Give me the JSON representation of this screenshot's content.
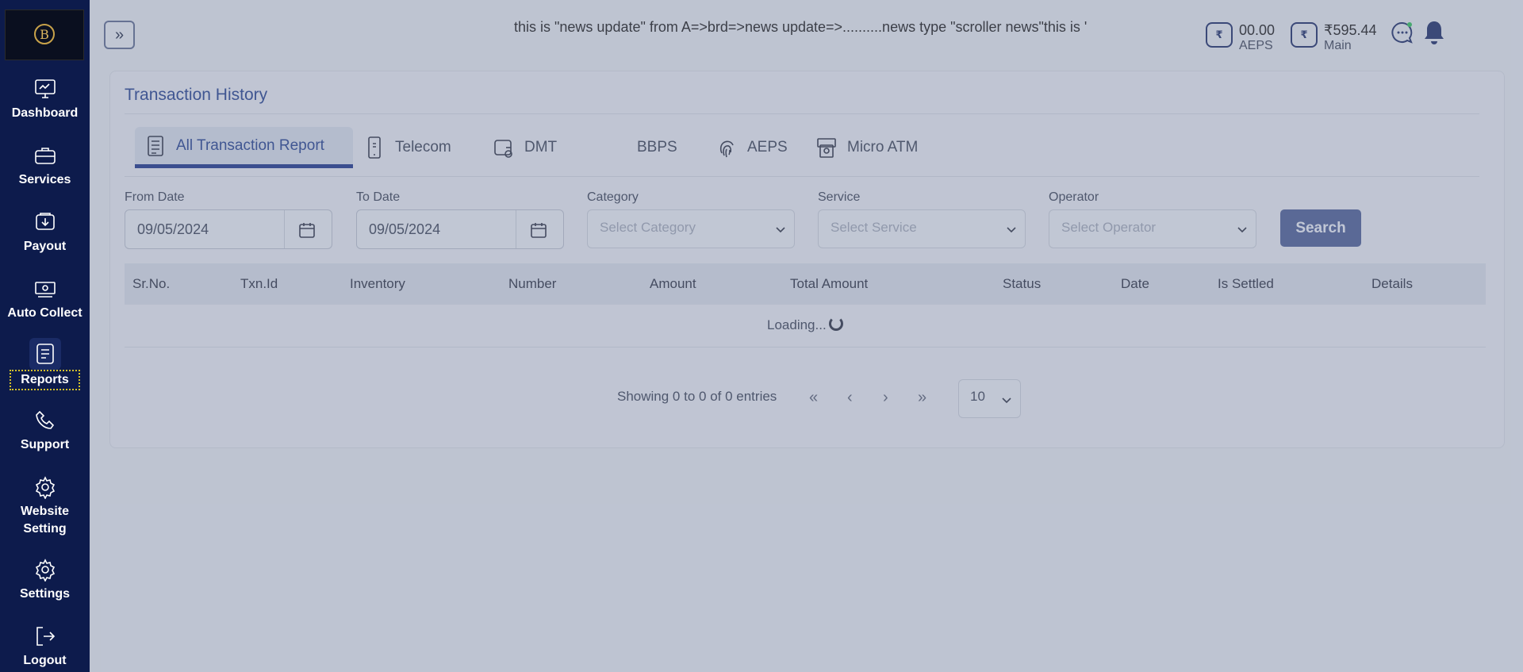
{
  "sidebar": {
    "logo_text": "B",
    "items": [
      {
        "label": "Dashboard",
        "icon": "dashboard-icon"
      },
      {
        "label": "Services",
        "icon": "briefcase-icon"
      },
      {
        "label": "Payout",
        "icon": "payout-icon"
      },
      {
        "label": "Auto Collect",
        "icon": "auto-collect-icon"
      },
      {
        "label": "Reports",
        "icon": "reports-icon"
      },
      {
        "label": "Support",
        "icon": "phone-icon"
      },
      {
        "label": "Website Setting",
        "icon": "gear-icon"
      },
      {
        "label": "Settings",
        "icon": "gear-icon"
      },
      {
        "label": "Logout",
        "icon": "logout-icon"
      }
    ]
  },
  "header": {
    "toggle_symbol": "»",
    "news": "this is \"news update\" from A=>brd=>news update=>..........news type \"scroller news\"this is '",
    "wallets": [
      {
        "amount": "00.00",
        "name": "AEPS"
      },
      {
        "amount": "₹595.44",
        "name": "Main"
      }
    ]
  },
  "page": {
    "title": "Transaction History",
    "tabs": [
      {
        "label": "All Transaction Report",
        "icon": "report-list-icon",
        "active": true
      },
      {
        "label": "Telecom",
        "icon": "mobile-icon"
      },
      {
        "label": "DMT",
        "icon": "wallet-transfer-icon"
      },
      {
        "label": "BBPS",
        "icon": ""
      },
      {
        "label": "AEPS",
        "icon": "fingerprint-icon"
      },
      {
        "label": "Micro ATM",
        "icon": "atm-icon"
      }
    ]
  },
  "filters": {
    "from_date_label": "From Date",
    "from_date_value": "09/05/2024",
    "to_date_label": "To Date",
    "to_date_value": "09/05/2024",
    "category_label": "Category",
    "category_placeholder": "Select Category",
    "service_label": "Service",
    "service_placeholder": "Select Service",
    "operator_label": "Operator",
    "operator_placeholder": "Select Operator",
    "search_label": "Search"
  },
  "table": {
    "columns": [
      "Sr.No.",
      "Txn.Id",
      "Inventory",
      "Number",
      "Amount",
      "Total Amount",
      "Status",
      "Date",
      "Is Settled",
      "Details"
    ],
    "loading_text": "Loading..."
  },
  "pagination": {
    "entries_text": "Showing 0 to 0 of 0 entries",
    "first": "«",
    "prev": "‹",
    "next": "›",
    "last": "»",
    "page_size": "10"
  }
}
